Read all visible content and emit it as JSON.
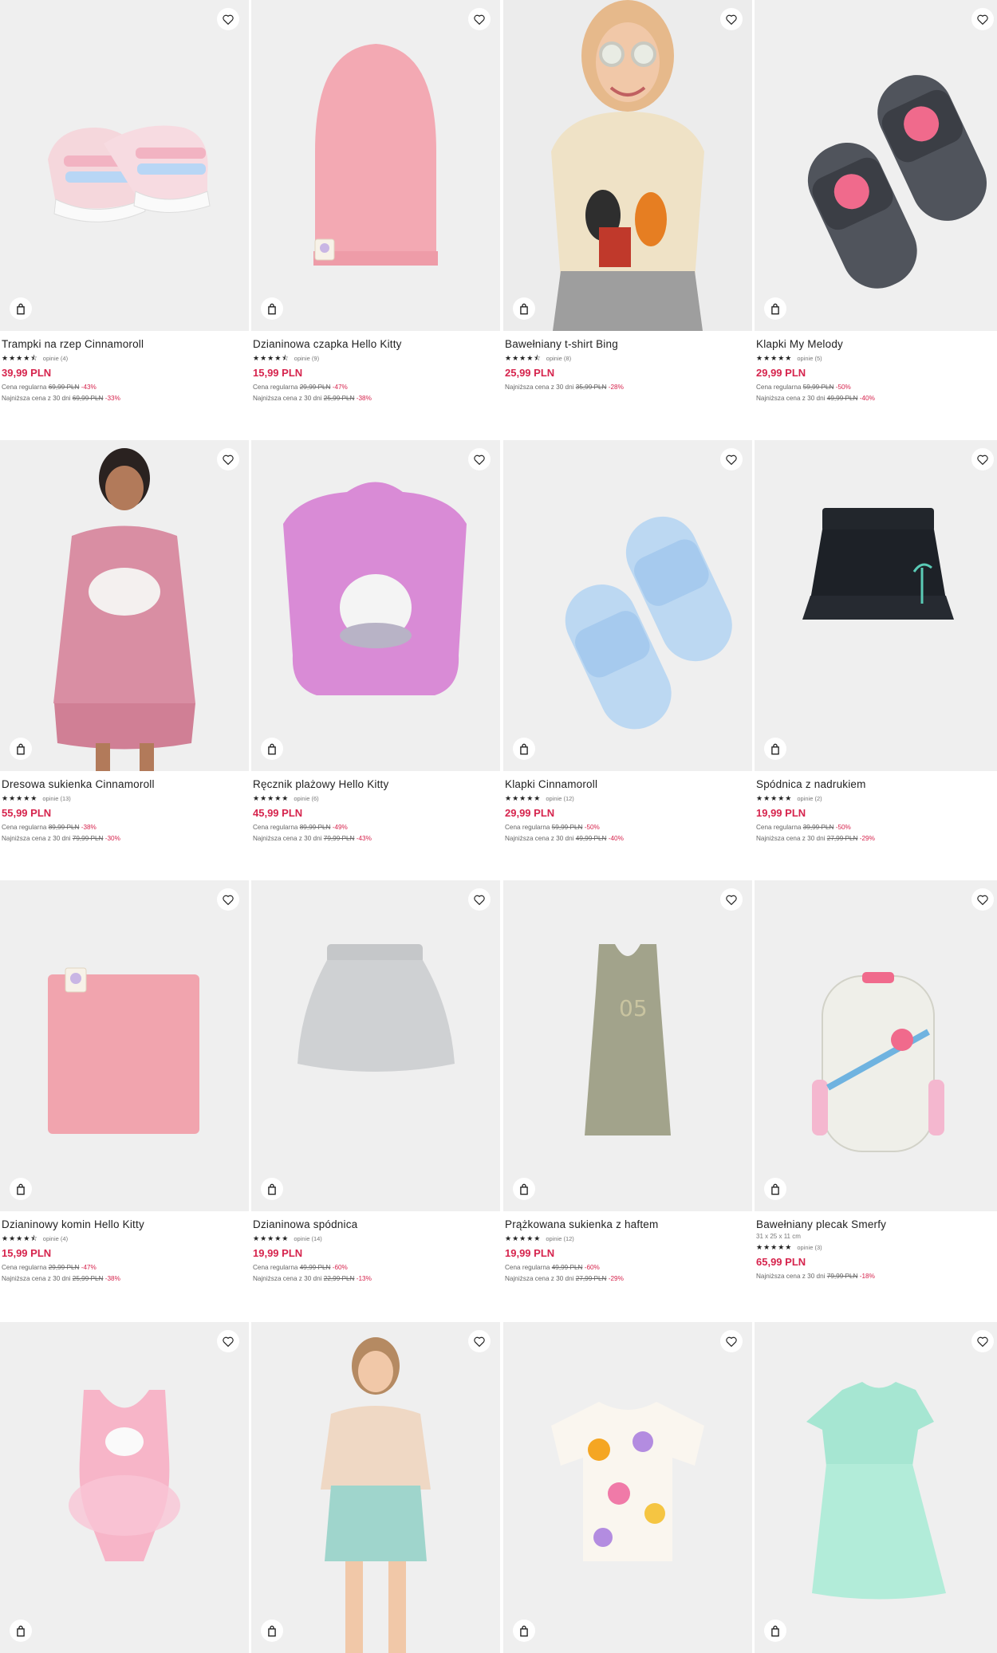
{
  "labels": {
    "rating_prefix": "opinie",
    "regular_label": "Cena regularna",
    "lowest_label": "Najniższa cena z 30 dni"
  },
  "products": [
    {
      "name": "Trampki na rzep Cinnamoroll",
      "stars": "★★★★⯪",
      "reviews": "opinie (4)",
      "price": "39,99 PLN",
      "regular_old": "69,99 PLN",
      "regular_pct": "-43%",
      "lowest_old": "69,99 PLN",
      "lowest_pct": "-33%",
      "image": "sneakers"
    },
    {
      "name": "Dzianinowa czapka Hello Kitty",
      "stars": "★★★★⯪",
      "reviews": "opinie (9)",
      "price": "15,99 PLN",
      "regular_old": "29,99 PLN",
      "regular_pct": "-47%",
      "lowest_old": "25,99 PLN",
      "lowest_pct": "-38%",
      "image": "beanie"
    },
    {
      "name": "Bawełniany t-shirt Bing",
      "stars": "★★★★⯪",
      "reviews": "opinie (8)",
      "price": "25,99 PLN",
      "regular_old": "",
      "regular_pct": "",
      "lowest_old": "35,99 PLN",
      "lowest_pct": "-28%",
      "image": "girl-tshirt"
    },
    {
      "name": "Klapki My Melody",
      "stars": "★★★★★",
      "reviews": "opinie (5)",
      "price": "29,99 PLN",
      "regular_old": "59,99 PLN",
      "regular_pct": "-50%",
      "lowest_old": "49,99 PLN",
      "lowest_pct": "-40%",
      "image": "slides-dark"
    },
    {
      "name": "Dresowa sukienka Cinnamoroll",
      "stars": "★★★★★",
      "reviews": "opinie (13)",
      "price": "55,99 PLN",
      "regular_old": "89,99 PLN",
      "regular_pct": "-38%",
      "lowest_old": "79,99 PLN",
      "lowest_pct": "-30%",
      "image": "girl-dress"
    },
    {
      "name": "Ręcznik plażowy Hello Kitty",
      "stars": "★★★★★",
      "reviews": "opinie (6)",
      "price": "45,99 PLN",
      "regular_old": "89,99 PLN",
      "regular_pct": "-49%",
      "lowest_old": "79,99 PLN",
      "lowest_pct": "-43%",
      "image": "towel"
    },
    {
      "name": "Klapki Cinnamoroll",
      "stars": "★★★★★",
      "reviews": "opinie (12)",
      "price": "29,99 PLN",
      "regular_old": "59,99 PLN",
      "regular_pct": "-50%",
      "lowest_old": "49,99 PLN",
      "lowest_pct": "-40%",
      "image": "slides-blue"
    },
    {
      "name": "Spódnica z nadrukiem",
      "stars": "★★★★★",
      "reviews": "opinie (2)",
      "price": "19,99 PLN",
      "regular_old": "39,99 PLN",
      "regular_pct": "-50%",
      "lowest_old": "27,99 PLN",
      "lowest_pct": "-29%",
      "image": "skirt-black"
    },
    {
      "name": "Dzianinowy komin Hello Kitty",
      "stars": "★★★★⯪",
      "reviews": "opinie (4)",
      "price": "15,99 PLN",
      "regular_old": "29,99 PLN",
      "regular_pct": "-47%",
      "lowest_old": "25,99 PLN",
      "lowest_pct": "-38%",
      "image": "snood"
    },
    {
      "name": "Dzianinowa spódnica",
      "stars": "★★★★★",
      "reviews": "opinie (14)",
      "price": "19,99 PLN",
      "regular_old": "49,99 PLN",
      "regular_pct": "-60%",
      "lowest_old": "22,99 PLN",
      "lowest_pct": "-13%",
      "image": "skirt-grey"
    },
    {
      "name": "Prążkowana sukienka z haftem",
      "stars": "★★★★★",
      "reviews": "opinie (12)",
      "price": "19,99 PLN",
      "regular_old": "49,99 PLN",
      "regular_pct": "-60%",
      "lowest_old": "27,99 PLN",
      "lowest_pct": "-29%",
      "image": "tank-dress"
    },
    {
      "name": "Bawełniany plecak Smerfy",
      "dimensions": "31 x 25 x 11 cm",
      "stars": "★★★★★",
      "reviews": "opinie (3)",
      "price": "65,99 PLN",
      "regular_old": "",
      "regular_pct": "",
      "lowest_old": "79,99 PLN",
      "lowest_pct": "-18%",
      "image": "backpack"
    },
    {
      "name": "",
      "image": "swimsuit"
    },
    {
      "name": "",
      "image": "girl-skirt"
    },
    {
      "name": "",
      "image": "flower-tee"
    },
    {
      "name": "",
      "image": "mint-dress"
    }
  ],
  "icons": {
    "favorite": "heart-outline-icon",
    "cart": "shopping-bag-icon"
  },
  "colors": {
    "price": "#d6244d",
    "image_bg": "#efefef",
    "text": "#222222"
  }
}
